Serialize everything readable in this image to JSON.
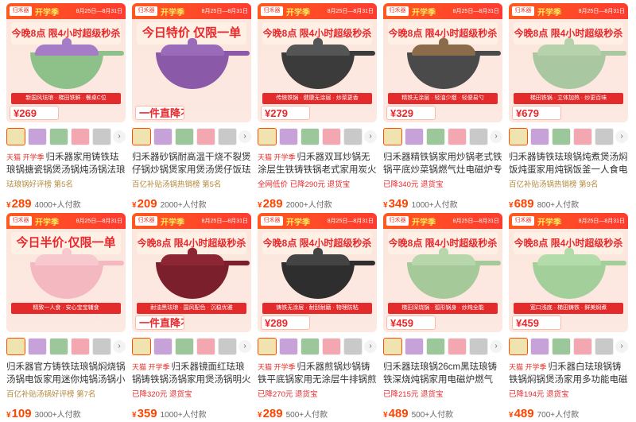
{
  "banner": {
    "brand": "归禾器",
    "campaign": "开学季",
    "dates": "8月25日—8月31日"
  },
  "products": [
    {
      "headline": "今晚8点 限4小时超级秒杀",
      "features": "新国风珐琅 · 梯田铁鲜 · 餐桌C位",
      "box_price": "¥269",
      "coupon": "",
      "pot": "#8ec08a",
      "lid": "#a57cc6",
      "tag": "天猫 开学季",
      "title": "归禾器家用铸铁珐琅锅搪瓷锅煲汤锅炖汤锅法琅锅",
      "sub": "珐琅锅好评榜 第5名",
      "sub_red": false,
      "price": "289",
      "paid": "4000+人付款"
    },
    {
      "headline": "今日特价 仅限一单",
      "features": "",
      "box_price": "一件直降不凑单",
      "coupon": "",
      "pot": "#8a5aa8",
      "lid": "#9a6bb8",
      "tag": "",
      "title": "归禾器砂锅耐高温干烧不裂煲仔锅炒锅煲家用煲汤煲仔饭珐琅锅",
      "sub": "百亿补贴汤锅热销榜 第5名",
      "sub_red": false,
      "price": "209",
      "paid": "2000+人付款"
    },
    {
      "headline": "今晚8点 限4小时超级秒杀",
      "features": "传统铁锅 · 健康无涂层 · 炒菜更香",
      "box_price": "¥279",
      "coupon": "",
      "pot": "#3b3b3b",
      "lid": "#555555",
      "tag": "天猫 开学季",
      "title": "归禾器双耳炒锅无涂层生铁铸铁锅老式家用炭火灶电",
      "sub": "全网低价 已降290元 退货宝",
      "sub_red": true,
      "price": "289",
      "paid": "2000+人付款"
    },
    {
      "headline": "今晚8点 限4小时超级秒杀",
      "features": "精铁无涂层 · 轻油少烟 · 轻便易勺",
      "box_price": "¥329",
      "coupon": "",
      "pot": "#4a4a4a",
      "lid": "#8b6b4a",
      "tag": "",
      "title": "归禾器精铁锅家用炒锅老式铁锅平底炒菜锅燃气灶电磁炉专",
      "sub": "已降340元 退货宝",
      "sub_red": true,
      "price": "349",
      "paid": "1000+人付款"
    },
    {
      "headline": "今晚8点 限4小时超级秒杀",
      "features": "梯田铁锅 · 立体加热 · 炒更百味",
      "box_price": "¥679",
      "coupon": "",
      "pot": "#a9c7a0",
      "lid": "#b6d2ab",
      "tag": "",
      "title": "归禾器铸铁珐琅锅炖煮煲汤焖饭炖蛋家用炖锅饭釜一人食电磁炉",
      "sub": "百亿补贴汤锅热销榜 第9名",
      "sub_red": false,
      "price": "689",
      "paid": "800+人付款"
    },
    {
      "headline": "今日半价·仅限一单",
      "features": "精致一人食 · 安心宝宝辅食",
      "box_price": "",
      "coupon": "",
      "pot": "#f4b8c0",
      "lid": "#f7c9cf",
      "tag": "",
      "title": "归禾器官方铸铁珐琅锅焖烧锅汤锅电饭家用迷你炖锅汤锅小号一",
      "sub": "百亿补贴汤锅好评榜 第7名",
      "sub_red": false,
      "price": "109",
      "paid": "3000+人付款"
    },
    {
      "headline": "今晚8点 限4小时超级秒杀",
      "features": "耐油黑珐琅 · 国风配色 · 沉稳优雅",
      "box_price": "一件直降不凑单",
      "coupon": "",
      "pot": "#7a1f2b",
      "lid": "#8c2632",
      "tag": "天猫 开学季",
      "title": "归禾器镜面红珐琅锅铸铁锅汤锅家用煲汤锅明火电磁",
      "sub": "已降320元 退货宝",
      "sub_red": true,
      "price": "359",
      "paid": "1000+人付款"
    },
    {
      "headline": "今晚8点 限4小时超级秒杀",
      "features": "铸铁无涂层 · 耐刮耐磨 · 物理防粘",
      "box_price": "¥289",
      "coupon": "",
      "pot": "#2e2e2e",
      "lid": "#444444",
      "tag": "天猫 开学季",
      "title": "归禾器煎锅炒锅铸铁平底锅家用无涂层牛排锅煎蛋锅",
      "sub": "已降270元 退货宝",
      "sub_red": true,
      "price": "289",
      "paid": "500+人付款"
    },
    {
      "headline": "今晚8点 限4小时超级秒杀",
      "features": "梯田深烧锅 · 弧形锅身 · 炒炖全能",
      "box_price": "¥459",
      "coupon": "",
      "pot": "#a6c99a",
      "lid": "#b7d6ab",
      "tag": "",
      "title": "归禾器珐琅锅26cm黑珐琅铸铁深烧炖锅家用电磁炉燃气",
      "sub": "已降215元 退货宝",
      "sub_red": true,
      "price": "489",
      "paid": "500+人付款"
    },
    {
      "headline": "今晚8点 限4小时超级秒杀",
      "features": "宽口浅底 · 梯田铸铁 · 鲜美焖煮",
      "box_price": "¥459",
      "coupon": "",
      "pot": "#a2cf9a",
      "lid": "#b3dcaa",
      "tag": "天猫 开学季",
      "title": "归禾器白珐琅锅铸铁锅焖锅煲汤家用多功能电磁炉锅",
      "sub": "已降194元 退货宝",
      "sub_red": true,
      "price": "489",
      "paid": "700+人付款"
    }
  ],
  "thumb_colors": [
    "#f1e3b0",
    "#c7a2d9",
    "#9cc79a",
    "#f2a7b1",
    "#c9c9c9"
  ],
  "arrow_glyph": "›"
}
